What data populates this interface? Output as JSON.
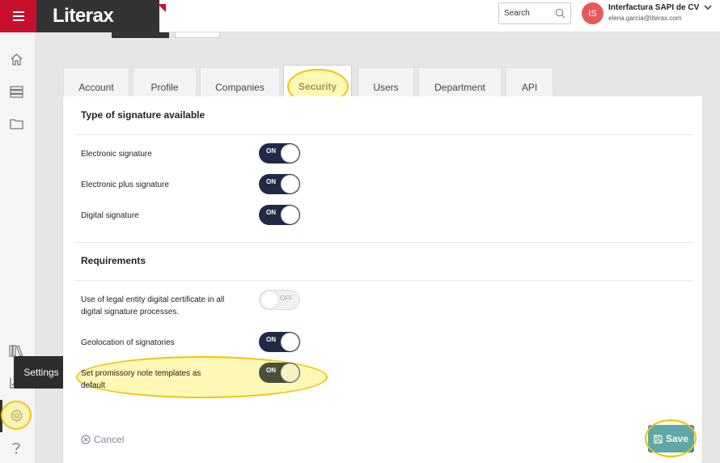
{
  "header": {
    "app_name": "Literax",
    "search_placeholder": "Search",
    "avatar_initials": "IS",
    "company_name": "Interfactura SAPI de CV",
    "user_email": "elena.garcia@literax.com"
  },
  "sidebar": {
    "tooltip": "Settings",
    "items": [
      {
        "icon": "home-icon"
      },
      {
        "icon": "list-icon"
      },
      {
        "icon": "folder-icon"
      },
      {
        "icon": "books-icon"
      },
      {
        "icon": "chart-icon"
      },
      {
        "icon": "gear-icon"
      },
      {
        "icon": "help-icon"
      }
    ]
  },
  "tabs": [
    {
      "label": "Account"
    },
    {
      "label": "Profile"
    },
    {
      "label": "Companies"
    },
    {
      "label": "Security"
    },
    {
      "label": "Users"
    },
    {
      "label": "Department"
    },
    {
      "label": "API"
    }
  ],
  "active_tab": "Security",
  "signatures": {
    "title": "Type of signature available",
    "items": [
      {
        "label": "Electronic signature",
        "state": "ON"
      },
      {
        "label": "Electronic plus signature",
        "state": "ON"
      },
      {
        "label": "Digital signature",
        "state": "ON"
      }
    ]
  },
  "requirements": {
    "title": "Requirements",
    "items": [
      {
        "label": "Use of legal entity digital certificate in all digital signature processes.",
        "state": "OFF"
      },
      {
        "label": "Geolocation of signatories",
        "state": "ON"
      },
      {
        "label": "Set promissory note templates as default",
        "state": "ON"
      }
    ]
  },
  "actions": {
    "cancel": "Cancel",
    "save": "Save"
  },
  "colors": {
    "brand_red": "#c8102e",
    "toggle_on": "#1f2a44",
    "save": "#2a8fb8",
    "highlight": "#f1c40f"
  }
}
